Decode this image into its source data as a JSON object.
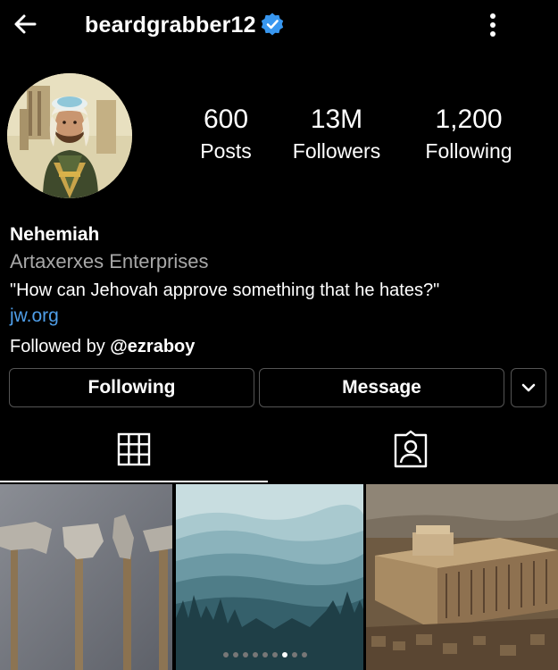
{
  "header": {
    "username": "beardgrabber12",
    "back_icon": "arrow-left-icon",
    "verified_icon": "verified-badge-icon",
    "more_icon": "more-vertical-icon"
  },
  "stats": [
    {
      "value": "600",
      "label": "Posts"
    },
    {
      "value": "13M",
      "label": "Followers"
    },
    {
      "value": "1,200",
      "label": "Following"
    }
  ],
  "bio": {
    "name": "Nehemiah",
    "category": "Artaxerxes Enterprises",
    "text": "\"How can Jehovah approve something that he hates?\"",
    "link": "jw.org",
    "followed_by_prefix": "Followed by ",
    "followed_by_user": "@ezraboy"
  },
  "buttons": {
    "following": "Following",
    "message": "Message",
    "dropdown_icon": "chevron-down-icon"
  },
  "tabs": [
    {
      "icon": "grid-icon",
      "active": true
    },
    {
      "icon": "tagged-person-icon",
      "active": false
    }
  ],
  "colors": {
    "background": "#000000",
    "link": "#4f9ee8",
    "verified": "#3897f0",
    "secondary_text": "#a8a8a8"
  },
  "carousel": {
    "count": 9,
    "active_index": 6
  }
}
